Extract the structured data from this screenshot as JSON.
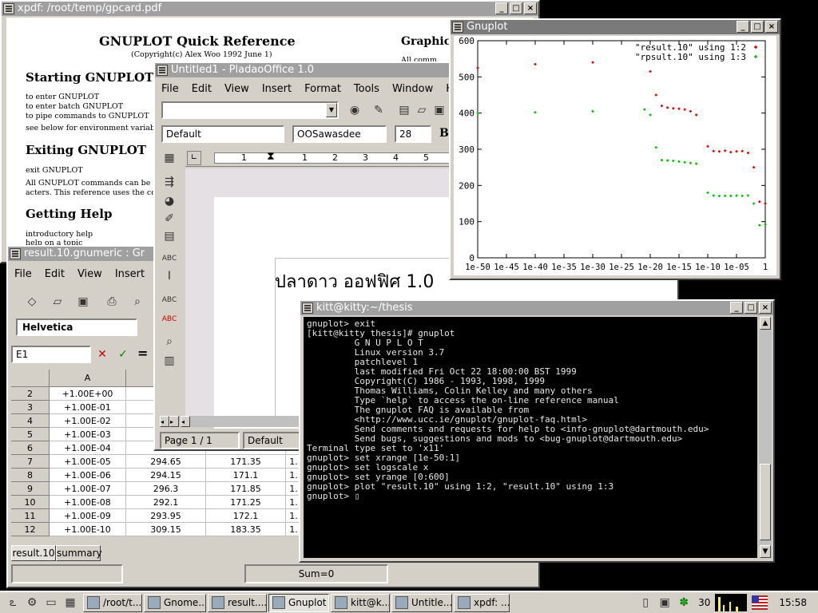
{
  "xpdf": {
    "title": "xpdf: /root/temp/gpcard.pdf",
    "doc_title": "GNUPLOT Quick Reference",
    "copyright": "(Copyright(c) Alex Woo 1992 June 1)",
    "right_heading": "Graphics",
    "right_text": "All comm",
    "sec_start": "Starting GNUPLOT",
    "start_1": "to enter GNUPLOT",
    "start_2": "to enter batch GNUPLOT",
    "start_3": "to pipe commands to GNUPLOT",
    "start_4": "see below for environment variables",
    "sec_exit": "Exiting GNUPLOT",
    "exit_1": "exit GNUPLOT",
    "exit_2": "All GNUPLOT commands can be a",
    "exit_3": "acters. This reference uses the comp",
    "sec_help": "Getting Help",
    "help_1": "introductory help",
    "help_2": "help on a topic"
  },
  "gnumeric": {
    "title": "result.10.gnumeric : Gr",
    "menu": [
      "File",
      "Edit",
      "View",
      "Insert",
      "F"
    ],
    "font": "Helvetica",
    "cell_ref": "E1",
    "eq": "=",
    "col_a": "A",
    "rows": [
      {
        "n": "2",
        "a": "+1.00E+00",
        "b": "",
        "c": "",
        "d": ""
      },
      {
        "n": "3",
        "a": "+1.00E-01",
        "b": "",
        "c": "",
        "d": ""
      },
      {
        "n": "4",
        "a": "+1.00E-02",
        "b": "",
        "c": "",
        "d": ""
      },
      {
        "n": "5",
        "a": "+1.00E-03",
        "b": "",
        "c": "",
        "d": ""
      },
      {
        "n": "6",
        "a": "+1.00E-04",
        "b": "",
        "c": "",
        "d": ""
      },
      {
        "n": "7",
        "a": "+1.00E-05",
        "b": "294.65",
        "c": "171.35",
        "d": "1."
      },
      {
        "n": "8",
        "a": "+1.00E-06",
        "b": "294.15",
        "c": "171.1",
        "d": "1."
      },
      {
        "n": "9",
        "a": "+1.00E-07",
        "b": "296.3",
        "c": "171.85",
        "d": "1."
      },
      {
        "n": "10",
        "a": "+1.00E-08",
        "b": "292.1",
        "c": "171.25",
        "d": "1."
      },
      {
        "n": "11",
        "a": "+1.00E-09",
        "b": "293.95",
        "c": "172.1",
        "d": "1."
      },
      {
        "n": "12",
        "a": "+1.00E-10",
        "b": "309.15",
        "c": "183.35",
        "d": "1."
      }
    ],
    "tabs": [
      "result.10",
      "summary"
    ],
    "sum": "Sum=0"
  },
  "pladao": {
    "title": "Untitled1 - PladaoOffice 1.0",
    "menu": [
      "File",
      "Edit",
      "View",
      "Insert",
      "Format",
      "Tools",
      "Window",
      "Help"
    ],
    "style": "Default",
    "font": "OOSawasdee",
    "size": "28",
    "bold": "B",
    "ruler": [
      "1",
      "1",
      "2",
      "3",
      "4",
      "5"
    ],
    "doc_text": "ปลาดาว ออฟฟิศ 1.0",
    "page": "Page 1 / 1",
    "page_style": "Default"
  },
  "gnuplot": {
    "title": "Gnuplot"
  },
  "chart_data": {
    "type": "scatter",
    "title": "",
    "xlabel": "",
    "ylabel": "",
    "x_scale": "log",
    "xlim": [
      1e-50,
      1
    ],
    "ylim": [
      0,
      600
    ],
    "x_tick_labels": [
      "1e-50",
      "1e-45",
      "1e-40",
      "1e-35",
      "1e-30",
      "1e-25",
      "1e-20",
      "1e-15",
      "1e-10",
      "1e-05",
      "1"
    ],
    "y_tick_labels": [
      "0",
      "100",
      "200",
      "300",
      "400",
      "500",
      "600"
    ],
    "legend_position": "top-right",
    "series": [
      {
        "name": "\"result.10\" using 1:2",
        "color": "#e00000",
        "points": [
          [
            1e-50,
            525
          ],
          [
            1e-40,
            535
          ],
          [
            1e-30,
            540
          ],
          [
            1e-20,
            515
          ],
          [
            1e-19,
            450
          ],
          [
            1e-18,
            420
          ],
          [
            1e-17,
            415
          ],
          [
            1e-16,
            413
          ],
          [
            1e-15,
            412
          ],
          [
            1e-14,
            410
          ],
          [
            1e-13,
            405
          ],
          [
            1e-12,
            395
          ],
          [
            1e-10,
            308
          ],
          [
            1e-09,
            295
          ],
          [
            1e-08,
            294
          ],
          [
            1e-07,
            296
          ],
          [
            1e-06,
            292
          ],
          [
            1e-05,
            294
          ],
          [
            0.0001,
            295
          ],
          [
            0.001,
            290
          ],
          [
            0.01,
            250
          ],
          [
            0.1,
            155
          ],
          [
            1,
            150
          ]
        ]
      },
      {
        "name": "\"rpsult.10\" using 1:3",
        "color": "#00c000",
        "points": [
          [
            1e-50,
            400
          ],
          [
            1e-40,
            402
          ],
          [
            1e-30,
            405
          ],
          [
            1e-21,
            410
          ],
          [
            1e-20,
            395
          ],
          [
            1e-19,
            305
          ],
          [
            1e-18,
            270
          ],
          [
            1e-17,
            269
          ],
          [
            1e-16,
            268
          ],
          [
            1e-15,
            266
          ],
          [
            1e-14,
            264
          ],
          [
            1e-13,
            262
          ],
          [
            1e-12,
            260
          ],
          [
            1e-10,
            180
          ],
          [
            1e-09,
            172
          ],
          [
            1e-08,
            171
          ],
          [
            1e-07,
            171.3
          ],
          [
            1e-06,
            171.1
          ],
          [
            1e-05,
            171.8
          ],
          [
            0.0001,
            171.2
          ],
          [
            0.001,
            172
          ],
          [
            0.01,
            150
          ],
          [
            0.1,
            90
          ],
          [
            1,
            92
          ]
        ]
      }
    ]
  },
  "terminal": {
    "title": "kitt@kitty:~/thesis",
    "lines": [
      "gnuplot> exit",
      "[kitt@kitty thesis]# gnuplot",
      "",
      "         G N U P L O T",
      "         Linux version 3.7",
      "         patchlevel 1",
      "         last modified Fri Oct 22 18:00:00 BST 1999",
      "",
      "         Copyright(C) 1986 - 1993, 1998, 1999",
      "         Thomas Williams, Colin Kelley and many others",
      "",
      "         Type `help` to access the on-line reference manual",
      "         The gnuplot FAQ is available from",
      "         <http://www.ucc.ie/gnuplot/gnuplot-faq.html>",
      "",
      "         Send comments and requests for help to <info-gnuplot@dartmouth.edu>",
      "         Send bugs, suggestions and mods to <bug-gnuplot@dartmouth.edu>",
      "",
      "",
      "Terminal type set to 'x11'",
      "gnuplot> set xrange [1e-50:1]",
      "gnuplot> set logscale x",
      "gnuplot> set yrange [0:600]",
      "gnuplot> plot \"result.10\" using 1:2, \"result.10\" using 1:3",
      "gnuplot> ▯"
    ]
  },
  "taskbar": {
    "tasks": [
      "/root/t...",
      "Gnome...",
      "result....",
      "Gnuplot",
      "kitt@k...",
      "Untitle...",
      "xpdf: ..."
    ],
    "desk_num": "30",
    "clock": "15:58"
  }
}
